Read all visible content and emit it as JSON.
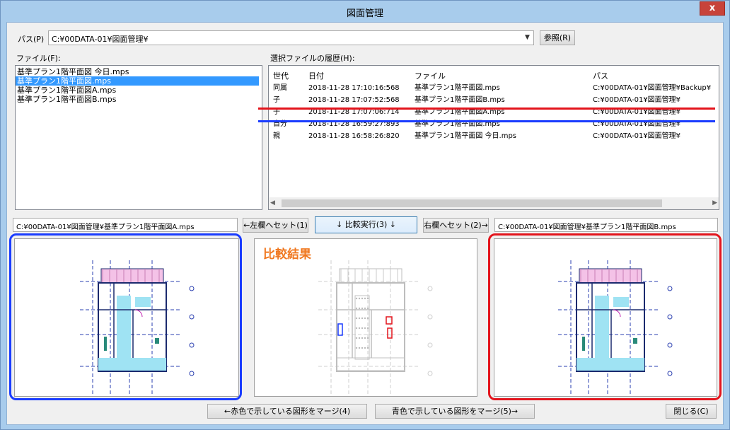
{
  "window": {
    "title": "図面管理",
    "close_symbol": "x"
  },
  "path": {
    "label": "パス(P)",
    "value": "C:¥00DATA-01¥図面管理¥",
    "browse_label": "参照(R)"
  },
  "files": {
    "label": "ファイル(F):",
    "items": [
      {
        "name": "基準プラン1階平面図 今日.mps",
        "selected": false
      },
      {
        "name": "基準プラン1階平面図.mps",
        "selected": true
      },
      {
        "name": "基準プラン1階平面図A.mps",
        "selected": false
      },
      {
        "name": "基準プラン1階平面図B.mps",
        "selected": false
      }
    ]
  },
  "history": {
    "label": "選択ファイルの履歴(H):",
    "columns": [
      "世代",
      "日付",
      "ファイル",
      "パス"
    ],
    "rows": [
      {
        "gen": "同属",
        "date": "2018-11-28 17:10:16:568",
        "file": "基準プラン1階平面図.mps",
        "path": "C:¥00DATA-01¥図面管理¥Backup¥"
      },
      {
        "gen": "子",
        "date": "2018-11-28 17:07:52:568",
        "file": "基準プラン1階平面図B.mps",
        "path": "C:¥00DATA-01¥図面管理¥"
      },
      {
        "gen": "子",
        "date": "2018-11-28 17:07:06:714",
        "file": "基準プラン1階平面図A.mps",
        "path": "C:¥00DATA-01¥図面管理¥"
      },
      {
        "gen": "自分",
        "date": "2018-11-28 16:59:27:893",
        "file": "基準プラン1階平面図.mps",
        "path": "C:¥00DATA-01¥図面管理¥"
      },
      {
        "gen": "親",
        "date": "2018-11-28 16:58:26:820",
        "file": "基準プラン1階平面図 今日.mps",
        "path": "C:¥00DATA-01¥図面管理¥"
      }
    ],
    "highlight_red_color": "#e3141c",
    "highlight_blue_color": "#1a3cff"
  },
  "compare": {
    "left_path": "C:¥00DATA-01¥図面管理¥基準プラン1階平面図A.mps",
    "right_path": "C:¥00DATA-01¥図面管理¥基準プラン1階平面図B.mps",
    "set_left_label": "←左欄へセット(1)",
    "run_label": "↓ 比較実行(3) ↓",
    "set_right_label": "右欄へセット(2)→",
    "result_title": "比較結果",
    "result_title_color": "#f07820"
  },
  "actions": {
    "merge_red_label": "←赤色で示している図形をマージ(4)",
    "merge_blue_label": "青色で示している図形をマージ(5)→",
    "close_label": "閉じる(C)"
  }
}
